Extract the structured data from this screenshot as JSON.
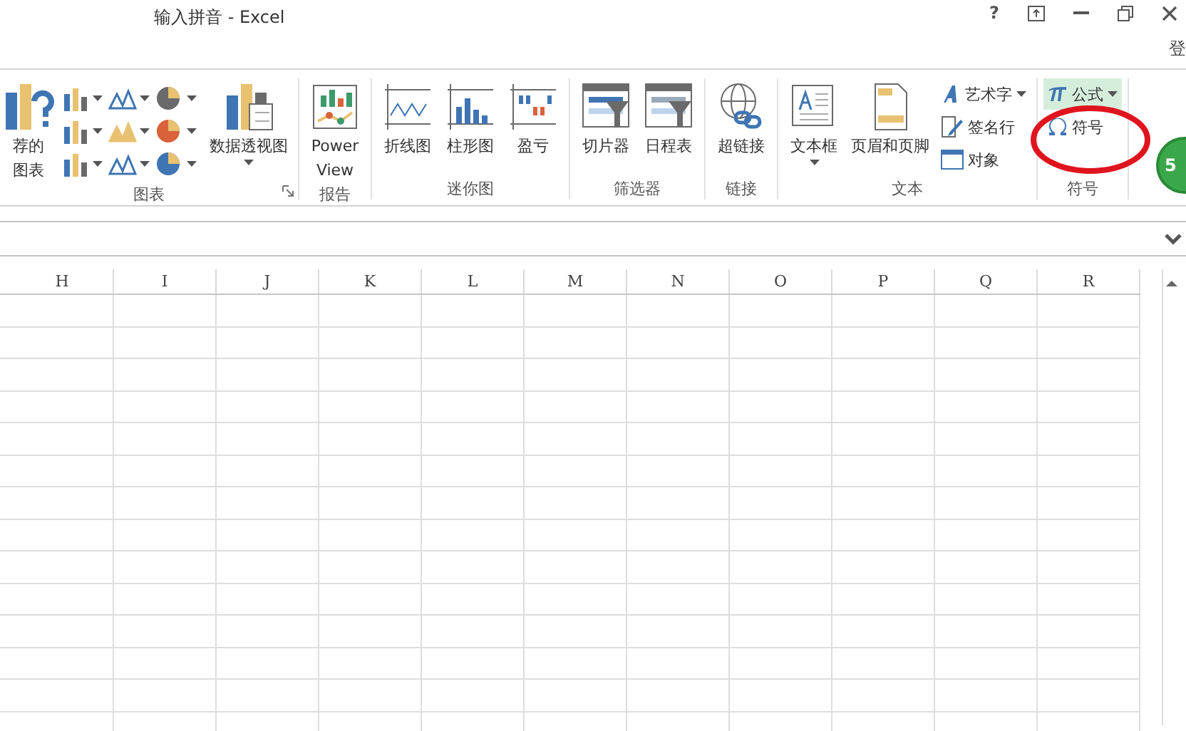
{
  "window": {
    "title": "输入拼音 - Excel",
    "help": "?",
    "account": "登"
  },
  "ribbon_groups": [
    {
      "label": "图表",
      "launcher": true,
      "items": [
        {
          "kind": "large",
          "lines": [
            "荐的",
            "图表"
          ],
          "dropdown": false
        },
        {
          "kind": "chart-grid"
        },
        {
          "kind": "large",
          "lines": [
            "数据透视图"
          ],
          "dropdown": true
        }
      ]
    },
    {
      "label": "报告",
      "items": [
        {
          "kind": "large",
          "lines": [
            "Power",
            "View"
          ],
          "dropdown": false
        }
      ]
    },
    {
      "label": "迷你图",
      "items": [
        {
          "kind": "large",
          "lines": [
            "折线图"
          ],
          "dropdown": false
        },
        {
          "kind": "large",
          "lines": [
            "柱形图"
          ],
          "dropdown": false
        },
        {
          "kind": "large",
          "lines": [
            "盈亏"
          ],
          "dropdown": false
        }
      ]
    },
    {
      "label": "筛选器",
      "items": [
        {
          "kind": "large",
          "lines": [
            "切片器"
          ],
          "dropdown": false
        },
        {
          "kind": "large",
          "lines": [
            "日程表"
          ],
          "dropdown": false
        }
      ]
    },
    {
      "label": "链接",
      "items": [
        {
          "kind": "large",
          "lines": [
            "超链接"
          ],
          "dropdown": false
        }
      ]
    },
    {
      "label": "文本",
      "items": [
        {
          "kind": "large",
          "lines": [
            "文本框"
          ],
          "dropdown": true
        },
        {
          "kind": "large",
          "lines": [
            "页眉和页脚"
          ],
          "dropdown": false
        },
        {
          "kind": "small-stack",
          "entries": [
            {
              "label": "艺术字",
              "dropdown": true,
              "selected": false
            },
            {
              "label": "签名行",
              "dropdown": false,
              "selected": false
            },
            {
              "label": "对象",
              "dropdown": false,
              "selected": false
            }
          ]
        }
      ]
    },
    {
      "label": "符号",
      "items": [
        {
          "kind": "small-stack",
          "entries": [
            {
              "label": "公式",
              "dropdown": true,
              "selected": true
            },
            {
              "label": "符号",
              "dropdown": false,
              "selected": false
            }
          ]
        }
      ]
    }
  ],
  "badge": "5",
  "columns": [
    "H",
    "I",
    "J",
    "K",
    "L",
    "M",
    "N",
    "O",
    "P",
    "Q",
    "R"
  ]
}
